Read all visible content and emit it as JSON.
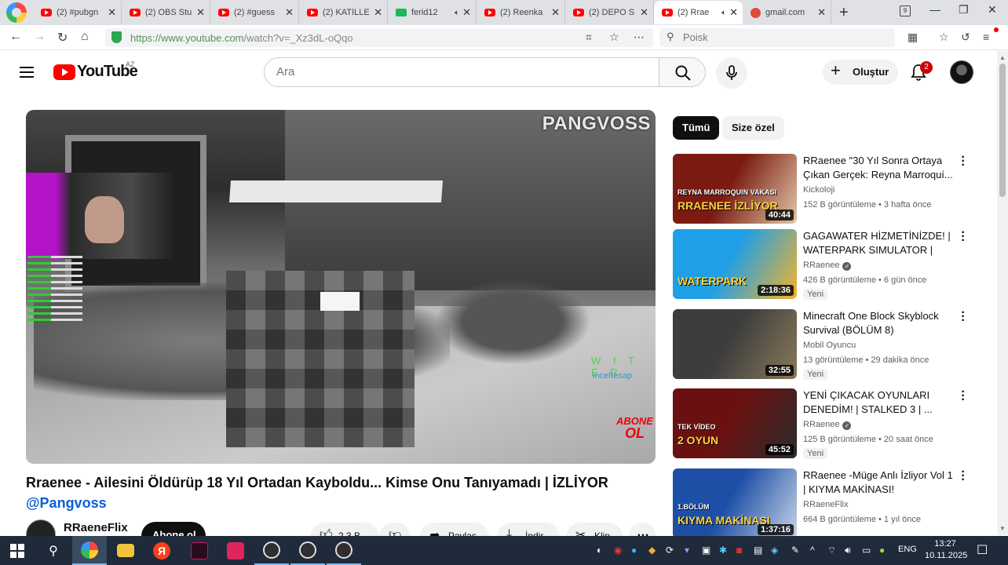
{
  "browser": {
    "tabs": [
      {
        "title": "(2) #pubgn",
        "icon": "youtube-favicon"
      },
      {
        "title": "(2) OBS Stu",
        "icon": "youtube-favicon"
      },
      {
        "title": "(2) #guess",
        "icon": "youtube-favicon"
      },
      {
        "title": "(2) KATİLLE",
        "icon": "youtube-favicon"
      },
      {
        "title": "ferid12",
        "icon": "kick-favicon"
      },
      {
        "title": "(2) Reenka",
        "icon": "youtube-favicon"
      },
      {
        "title": "(2) DEPO S",
        "icon": "youtube-favicon"
      },
      {
        "title": "(2) Rrae",
        "icon": "youtube-favicon",
        "active": true
      },
      {
        "title": "gmail.com",
        "icon": "gmail-favicon"
      }
    ],
    "tab_count_badge": "9",
    "url_host": "https://www.youtube.com",
    "url_path": "/watch?v=_Xz3dL-oQqo",
    "search_placeholder": "Poisk"
  },
  "youtube": {
    "wordmark": "YouTube",
    "region": "AZ",
    "search_placeholder": "Ara",
    "create_label": "Oluştur",
    "notification_count": "2"
  },
  "player": {
    "watermark": "PANGVOSS",
    "overlay_green": "W I T E R",
    "overlay_blue": "incehesap",
    "abone_top": "ABONE",
    "abone_big": "OL"
  },
  "video": {
    "title": "Rraenee - Ailesini Öldürüp 18 Yıl Ortadan Kayboldu... Kimse Onu Tanıyamadı | İZLİYOR",
    "hashtag": "@Pangvoss",
    "channel": "RRaeneFlix",
    "subscribe_label": "Abone ol",
    "likes": "2,3 B",
    "share_label": "Paylaş",
    "download_label": "İndir",
    "clip_label": "Klip"
  },
  "sidebar": {
    "chips": [
      "Tümü",
      "Size özel"
    ],
    "recommendations": [
      {
        "title": "RRaenee \"30 Yıl Sonra Ortaya Çıkan Gerçek: Reyna Marroquí...",
        "channel": "Kickoloji",
        "verified": false,
        "meta": "152 B görüntüleme • 3 hafta önce",
        "duration": "40:44",
        "badge": "",
        "thumb_text": "RRAENEE İZLİYOR",
        "thumb_sub": "REYNA MARROQUIN VAKASI",
        "thumb_colors": [
          "#7a1a10",
          "#e2c9a8"
        ]
      },
      {
        "title": "GAGAWATER HİZMETİNİZDE! | WATERPARK SIMULATOR |",
        "channel": "RRaenee",
        "verified": true,
        "meta": "426 B görüntüleme • 6 gün önce",
        "duration": "2:18:36",
        "badge": "Yeni",
        "thumb_text": "WATERPARK",
        "thumb_sub": "",
        "thumb_colors": [
          "#1f9fe6",
          "#f7b32a"
        ]
      },
      {
        "title": "Minecraft One Block Skyblock Survival (BÖLÜM 8)",
        "channel": "Mobil Oyuncu",
        "verified": false,
        "meta": "13 görüntüleme • 29 dakika önce",
        "duration": "32:55",
        "badge": "Yeni",
        "thumb_text": "",
        "thumb_sub": "",
        "thumb_colors": [
          "#3d3d3d",
          "#8a7a5a"
        ]
      },
      {
        "title": "YENİ ÇIKACAK OYUNLARI DENEDİM! | STALKED 3 | ...",
        "channel": "RRaenee",
        "verified": true,
        "meta": "125 B görüntüleme • 20 saat önce",
        "duration": "45:52",
        "badge": "Yeni",
        "thumb_text": "2 OYUN",
        "thumb_sub": "TEK VİDEO",
        "thumb_colors": [
          "#6b1010",
          "#2b2b2b"
        ]
      },
      {
        "title": "RRaenee -Müge Anlı İzliyor Vol 1 | KIYMA MAKİNASI!",
        "channel": "RRaeneFlix",
        "verified": false,
        "meta": "664 B görüntüleme • 1 yıl önce",
        "duration": "1:37:16",
        "badge": "",
        "thumb_text": "KIYMA MAKİNASI",
        "thumb_sub": "1.BÖLÜM",
        "thumb_colors": [
          "#1d4fa6",
          "#c9d4e6"
        ]
      }
    ]
  },
  "taskbar": {
    "language": "ENG",
    "time": "13:27",
    "date": "10.11.2025"
  }
}
